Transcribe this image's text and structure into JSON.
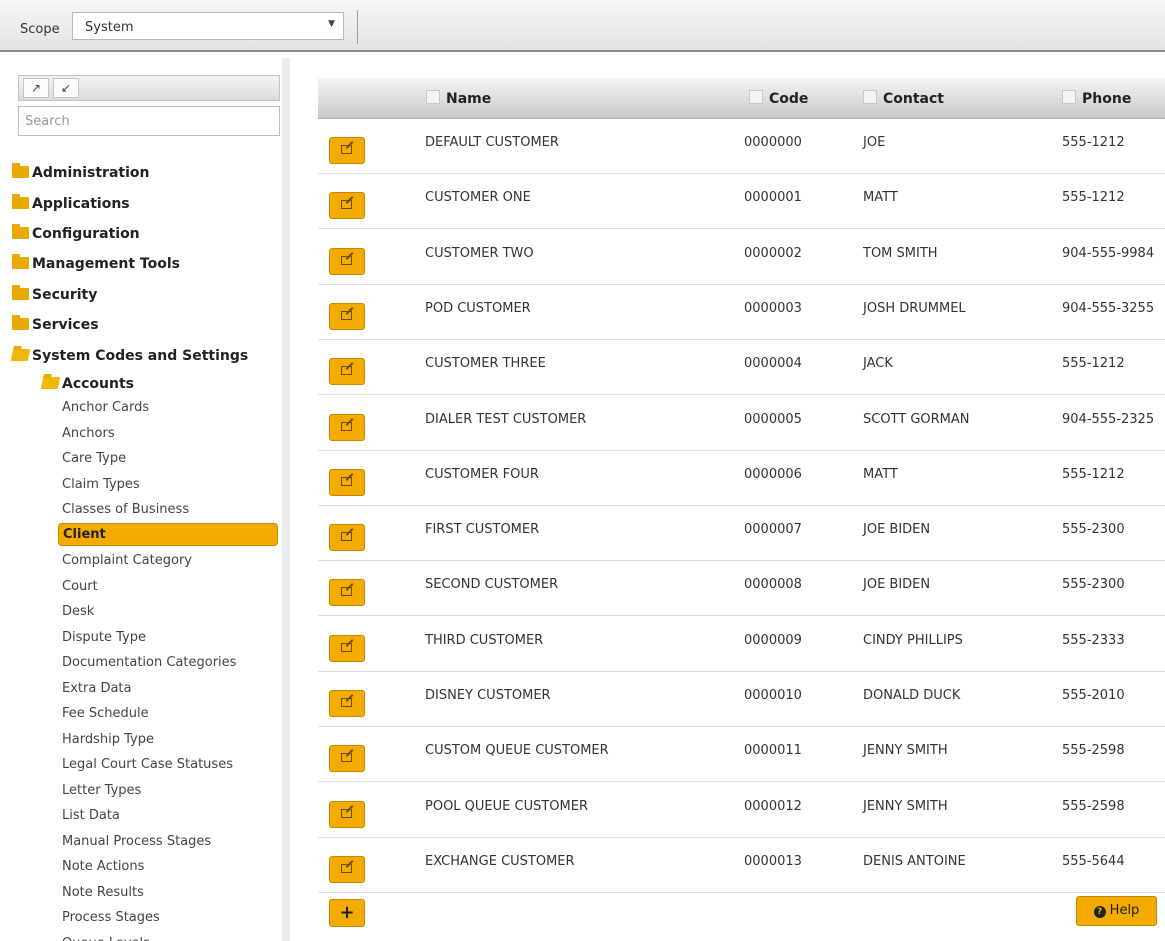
{
  "scope": {
    "label": "Scope",
    "value": "System"
  },
  "tree": {
    "search_placeholder": "Search",
    "expand_all": "↗",
    "collapse_all": "↙",
    "folders": [
      "Administration",
      "Applications",
      "Configuration",
      "Management Tools",
      "Security",
      "Services",
      "System Codes and Settings",
      "Accounts"
    ],
    "leaves": [
      "Anchor Cards",
      "Anchors",
      "Care Type",
      "Claim Types",
      "Classes of Business",
      "Client",
      "Complaint Category",
      "Court",
      "Desk",
      "Dispute Type",
      "Documentation Categories",
      "Extra Data",
      "Fee Schedule",
      "Hardship Type",
      "Legal Court Case Statuses",
      "Letter Types",
      "List Data",
      "Manual Process Stages",
      "Note Actions",
      "Note Results",
      "Process Stages",
      "Queue Levels"
    ],
    "selected": "Client"
  },
  "table": {
    "columns": [
      "Name",
      "Code",
      "Contact",
      "Phone"
    ],
    "rows": [
      {
        "name": "DEFAULT CUSTOMER",
        "code": "0000000",
        "contact": "JOE",
        "phone": "555-1212"
      },
      {
        "name": "CUSTOMER ONE",
        "code": "0000001",
        "contact": "MATT",
        "phone": "555-1212"
      },
      {
        "name": "CUSTOMER TWO",
        "code": "0000002",
        "contact": "TOM SMITH",
        "phone": "904-555-9984"
      },
      {
        "name": "POD CUSTOMER",
        "code": "0000003",
        "contact": "JOSH DRUMMEL",
        "phone": "904-555-3255"
      },
      {
        "name": "CUSTOMER THREE",
        "code": "0000004",
        "contact": "JACK",
        "phone": "555-1212"
      },
      {
        "name": "DIALER TEST CUSTOMER",
        "code": "0000005",
        "contact": "SCOTT GORMAN",
        "phone": "904-555-2325"
      },
      {
        "name": "CUSTOMER FOUR",
        "code": "0000006",
        "contact": "MATT",
        "phone": "555-1212"
      },
      {
        "name": "FIRST CUSTOMER",
        "code": "0000007",
        "contact": "JOE BIDEN",
        "phone": "555-2300"
      },
      {
        "name": "SECOND CUSTOMER",
        "code": "0000008",
        "contact": "JOE BIDEN",
        "phone": "555-2300"
      },
      {
        "name": "THIRD CUSTOMER",
        "code": "0000009",
        "contact": "CINDY PHILLIPS",
        "phone": "555-2333"
      },
      {
        "name": "DISNEY CUSTOMER",
        "code": "0000010",
        "contact": "DONALD DUCK",
        "phone": "555-2010"
      },
      {
        "name": "CUSTOM QUEUE CUSTOMER",
        "code": "0000011",
        "contact": "JENNY SMITH",
        "phone": "555-2598"
      },
      {
        "name": "POOL QUEUE CUSTOMER",
        "code": "0000012",
        "contact": "JENNY SMITH",
        "phone": "555-2598"
      },
      {
        "name": "EXCHANGE CUSTOMER",
        "code": "0000013",
        "contact": "DENIS ANTOINE",
        "phone": "555-5644"
      }
    ]
  },
  "buttons": {
    "add": "+",
    "help": "Help"
  },
  "colors": {
    "accent": "#f4ab00",
    "accent_border": "#c58800",
    "folder": "#e8a900"
  }
}
